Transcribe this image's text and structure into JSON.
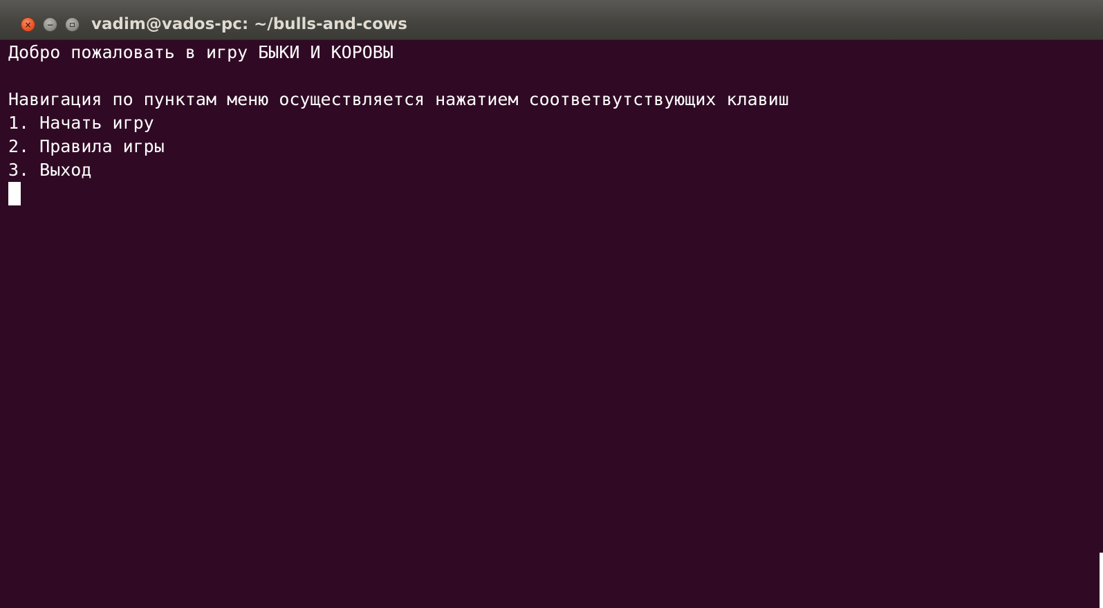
{
  "window": {
    "title": "vadim@vados-pc: ~/bulls-and-cows",
    "buttons": {
      "close_glyph": "×",
      "minimize_glyph": "−"
    }
  },
  "terminal": {
    "lines": [
      "Добро пожаловать в игру БЫКИ И КОРОВЫ",
      "",
      "Навигация по пунктам меню осуществляется нажатием соответвутствующих клавиш",
      "1. Начать игру",
      "2. Правила игры",
      "3. Выход"
    ]
  },
  "colors": {
    "terminal_background": "#300a24",
    "terminal_foreground": "#ffffff",
    "titlebar": "#3c3b37",
    "close_button": "#e8582a"
  }
}
